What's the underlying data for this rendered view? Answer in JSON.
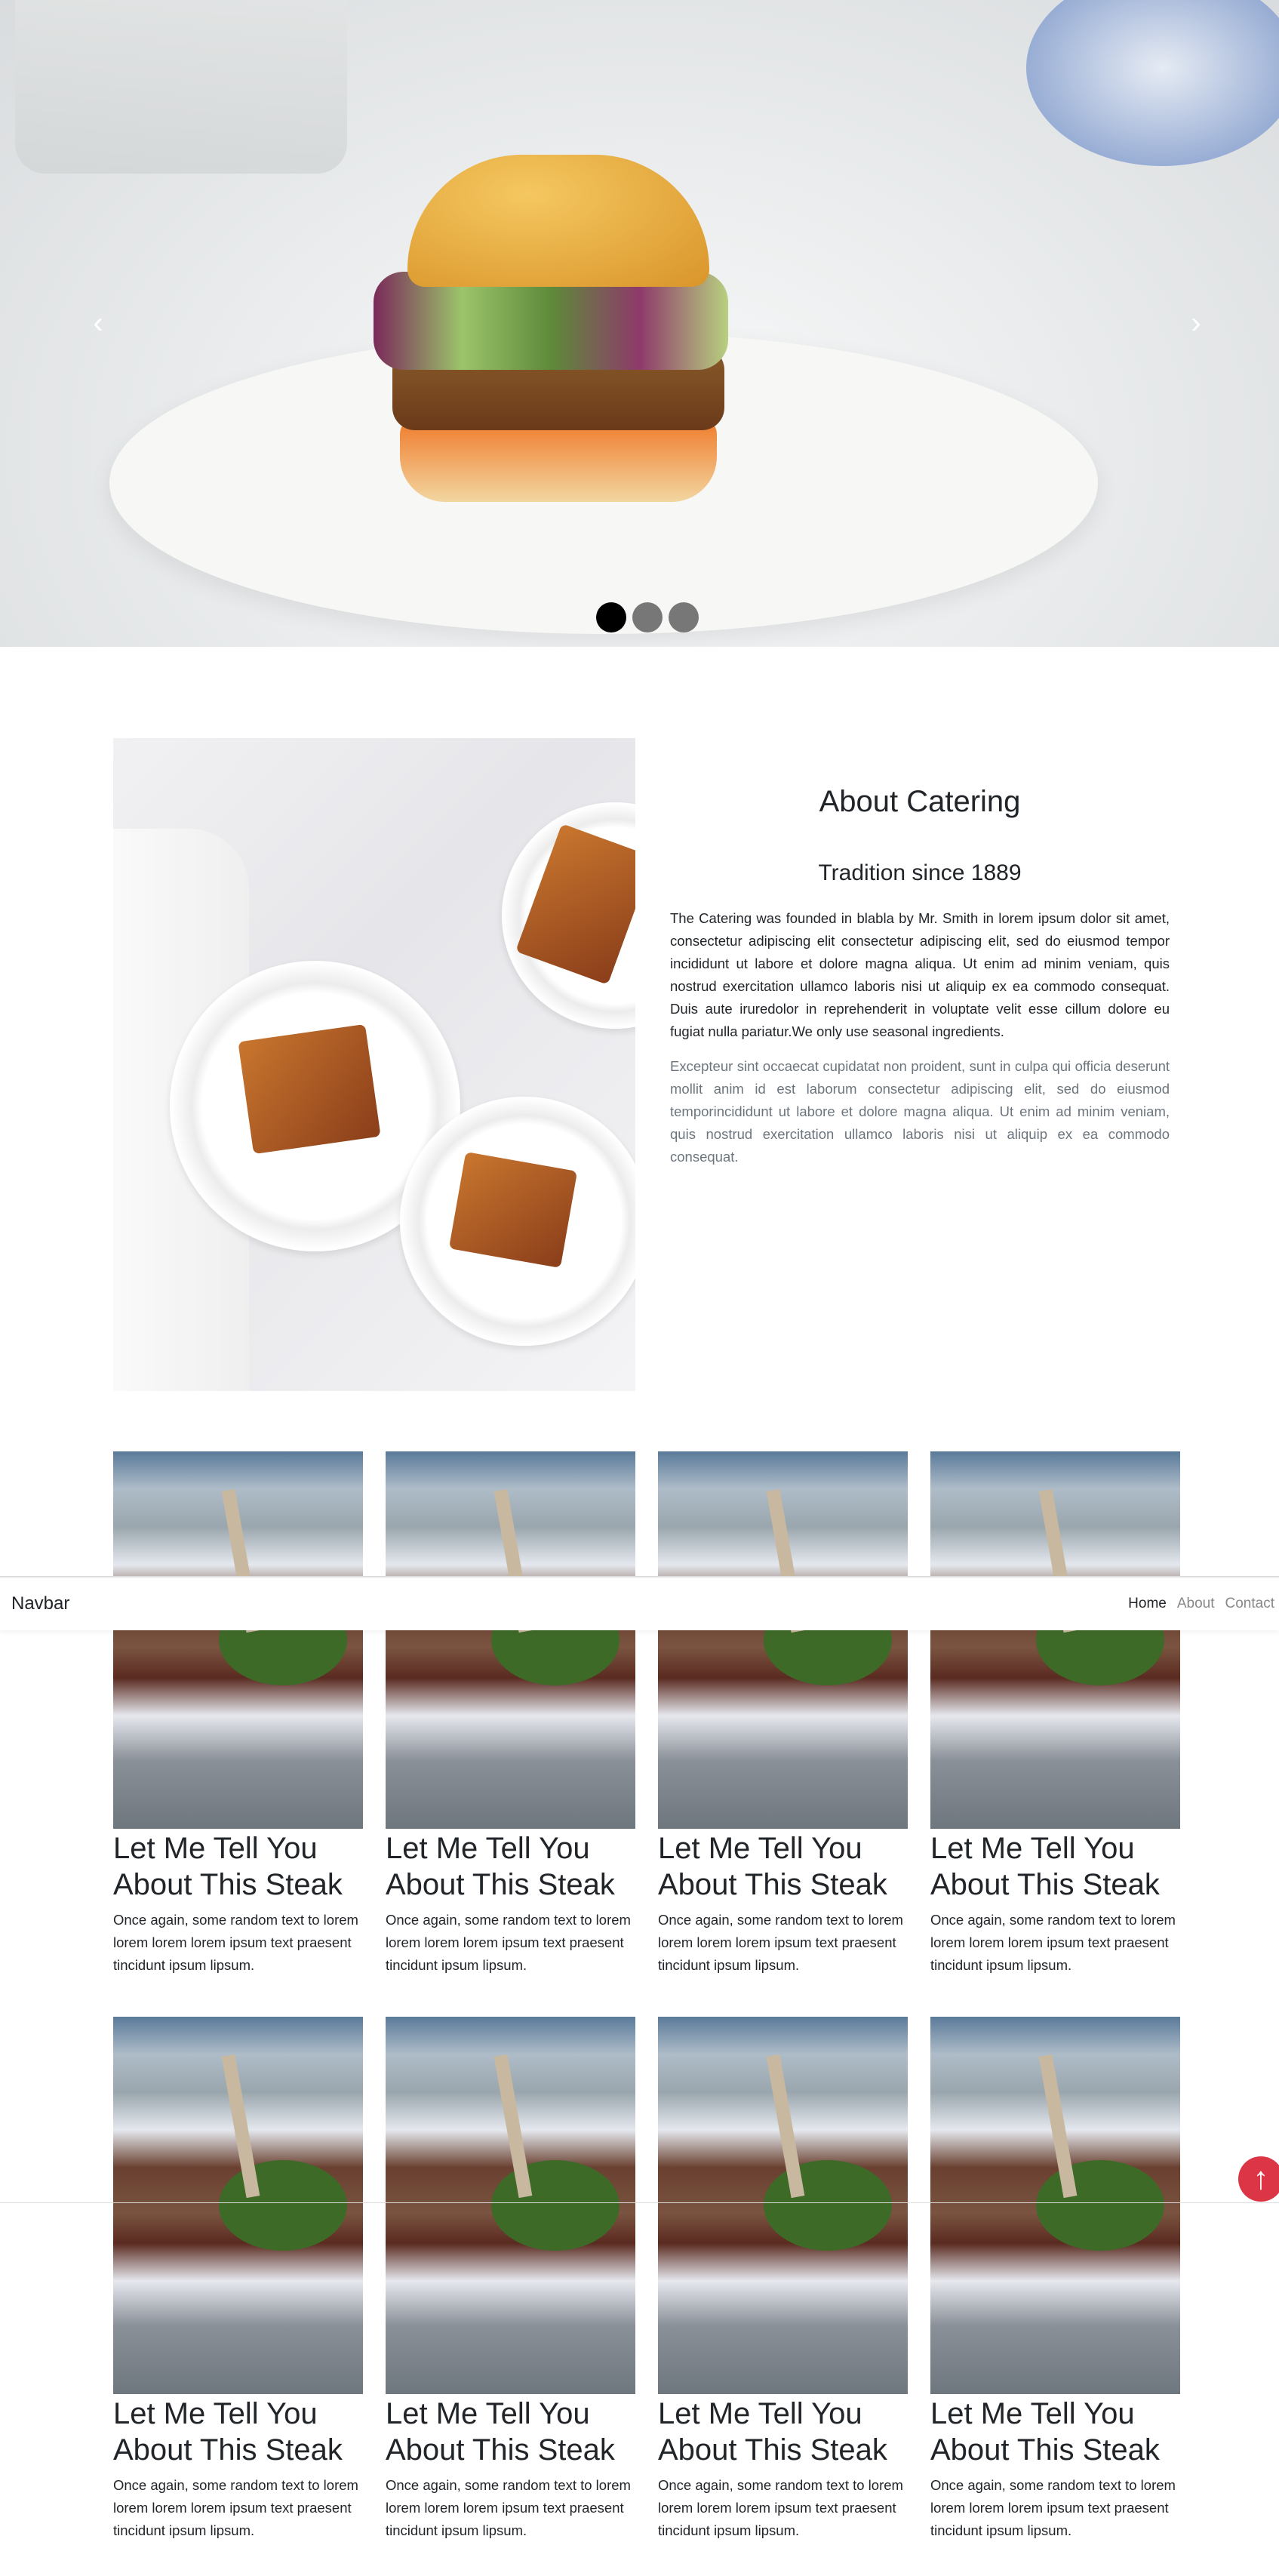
{
  "carousel": {
    "prev_icon": "chevron-left-icon",
    "next_icon": "chevron-right-icon",
    "slide_count": 3,
    "active_index": 0
  },
  "about": {
    "title": "About Catering",
    "subtitle": "Tradition since 1889",
    "paragraph1": "The Catering was founded in blabla by Mr. Smith in lorem ipsum dolor sit amet, consectetur adipiscing elit consectetur adipiscing elit, sed do eiusmod tempor incididunt ut labore et dolore magna aliqua. Ut enim ad minim veniam, quis nostrud exercitation ullamco laboris nisi ut aliquip ex ea commodo consequat. Duis aute iruredolor in reprehenderit in voluptate velit esse cillum dolore eu fugiat nulla pariatur.We only use seasonal ingredients.",
    "paragraph2": "Excepteur sint occaecat cupidatat non proident, sunt in culpa qui officia deserunt mollit anim id est laborum consectetur adipiscing elit, sed do eiusmod temporincididunt ut labore et dolore magna aliqua. Ut enim ad minim veniam, quis nostrud exercitation ullamco laboris nisi ut aliquip ex ea commodo consequat."
  },
  "cards": [
    {
      "title": "Let Me Tell You About This Steak",
      "text": "Once again, some random text to lorem lorem lorem lorem ipsum text praesent tincidunt ipsum lipsum."
    },
    {
      "title": "Let Me Tell You About This Steak",
      "text": "Once again, some random text to lorem lorem lorem lorem ipsum text praesent tincidunt ipsum lipsum."
    },
    {
      "title": "Let Me Tell You About This Steak",
      "text": "Once again, some random text to lorem lorem lorem lorem ipsum text praesent tincidunt ipsum lipsum."
    },
    {
      "title": "Let Me Tell You About This Steak",
      "text": "Once again, some random text to lorem lorem lorem lorem ipsum text praesent tincidunt ipsum lipsum."
    },
    {
      "title": "Let Me Tell You About This Steak",
      "text": "Once again, some random text to lorem lorem lorem lorem ipsum text praesent tincidunt ipsum lipsum."
    },
    {
      "title": "Let Me Tell You About This Steak",
      "text": "Once again, some random text to lorem lorem lorem lorem ipsum text praesent tincidunt ipsum lipsum."
    },
    {
      "title": "Let Me Tell You About This Steak",
      "text": "Once again, some random text to lorem lorem lorem lorem ipsum text praesent tincidunt ipsum lipsum."
    },
    {
      "title": "Let Me Tell You About This Steak",
      "text": "Once again, some random text to lorem lorem lorem lorem ipsum text praesent tincidunt ipsum lipsum."
    }
  ],
  "navbar": {
    "brand": "Navbar",
    "links": [
      "Home",
      "About",
      "Contact"
    ],
    "active": "Home"
  },
  "scroll_top": {
    "icon": "arrow-up-icon",
    "color": "#dc3545"
  }
}
